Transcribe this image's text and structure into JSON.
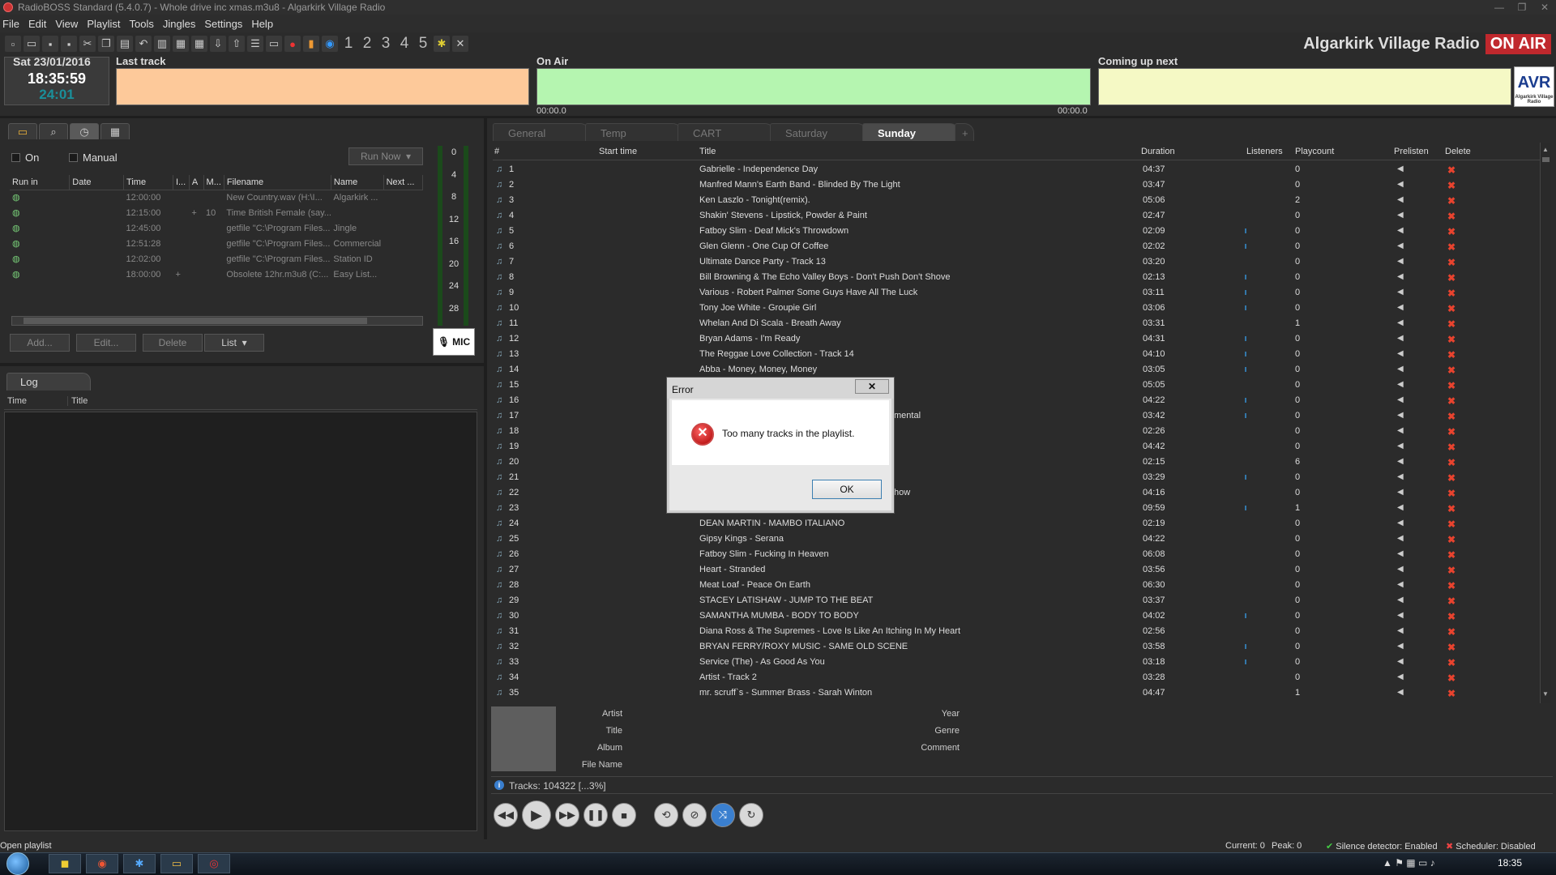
{
  "window": {
    "title": "RadioBOSS Standard (5.4.0.7) - Whole drive inc xmas.m3u8 - Algarkirk Village Radio"
  },
  "menu": [
    "File",
    "Edit",
    "View",
    "Playlist",
    "Tools",
    "Jingles",
    "Settings",
    "Help"
  ],
  "toolbar_numbers": [
    "1",
    "2",
    "3",
    "4",
    "5"
  ],
  "station": {
    "name": "Algarkirk Village Radio",
    "on_air": "ON AIR",
    "logo": "AVR",
    "logo_sub": "Algarkirk Village Radio"
  },
  "clock": {
    "date": "Sat 23/01/2016",
    "time": "18:35:59",
    "elapsed": "24:01"
  },
  "last_track": {
    "label": "Last track",
    "color": "#fdc99a"
  },
  "on_air_bar": {
    "label": "On Air",
    "color": "#b5f5b0",
    "start": "00:00.0",
    "end": "00:00.0"
  },
  "coming_up": {
    "label": "Coming up next",
    "color": "#f5f9c5"
  },
  "scheduler": {
    "on_label": "On",
    "manual_label": "Manual",
    "run_now": "Run Now",
    "columns": [
      "Run in",
      "Date",
      "Time",
      "I...",
      "A",
      "M...",
      "Filename",
      "Name",
      "Next ..."
    ],
    "rows": [
      {
        "time": "12:00:00",
        "i": "",
        "a": "",
        "m": "",
        "filename": "New Country.wav  (H:\\I...",
        "name": "Algarkirk ..."
      },
      {
        "time": "12:15:00",
        "i": "",
        "a": "+",
        "m": "10",
        "filename": "Time British Female  (say...",
        "name": ""
      },
      {
        "time": "12:45:00",
        "i": "",
        "a": "",
        "m": "",
        "filename": "getfile \"C:\\Program Files...",
        "name": "Jingle"
      },
      {
        "time": "12:51:28",
        "i": "",
        "a": "",
        "m": "",
        "filename": "getfile \"C:\\Program Files...",
        "name": "Commercial"
      },
      {
        "time": "12:02:00",
        "i": "",
        "a": "",
        "m": "",
        "filename": "getfile \"C:\\Program Files...",
        "name": "Station ID"
      },
      {
        "time": "18:00:00",
        "i": "+",
        "a": "",
        "m": "",
        "filename": "Obsolete 12hr.m3u8  (C:...",
        "name": "Easy List..."
      }
    ],
    "buttons": {
      "add": "Add...",
      "edit": "Edit...",
      "delete": "Delete",
      "list": "List"
    }
  },
  "vu_scale": [
    "0",
    "4",
    "8",
    "12",
    "16",
    "20",
    "24",
    "28"
  ],
  "mic_label": "MIC",
  "log": {
    "tab": "Log",
    "columns": [
      "Time",
      "Title"
    ]
  },
  "playlist_tabs": [
    "General",
    "Temp",
    "CART",
    "Saturday",
    "Sunday"
  ],
  "playlist": {
    "columns": [
      "#",
      "Start time",
      "Title",
      "Duration",
      "Listeners",
      "Playcount",
      "Prelisten",
      "Delete"
    ],
    "rows": [
      {
        "n": "1",
        "title": "Gabrielle - Independence Day",
        "dur": "04:37",
        "pc": "0"
      },
      {
        "n": "2",
        "title": "Manfred Mann's Earth Band - Blinded By The Light",
        "dur": "03:47",
        "pc": "0"
      },
      {
        "n": "3",
        "title": "Ken Laszlo - Tonight(remix).",
        "dur": "05:06",
        "pc": "2"
      },
      {
        "n": "4",
        "title": "Shakin' Stevens - Lipstick, Powder & Paint",
        "dur": "02:47",
        "pc": "0"
      },
      {
        "n": "5",
        "title": "Fatboy Slim - Deaf Mick's Throwdown",
        "dur": "02:09",
        "pc": "0"
      },
      {
        "n": "6",
        "title": "Glen Glenn - One Cup Of Coffee",
        "dur": "02:02",
        "pc": "0"
      },
      {
        "n": "7",
        "title": "Ultimate Dance Party - Track 13",
        "dur": "03:20",
        "pc": "0"
      },
      {
        "n": "8",
        "title": "Bill Browning & The Echo Valley Boys - Don't Push Don't Shove",
        "dur": "02:13",
        "pc": "0"
      },
      {
        "n": "9",
        "title": "Various - Robert Palmer  Some Guys Have All The Luck",
        "dur": "03:11",
        "pc": "0"
      },
      {
        "n": "10",
        "title": "Tony Joe White - Groupie Girl",
        "dur": "03:06",
        "pc": "0"
      },
      {
        "n": "11",
        "title": "Whelan And Di Scala - Breath Away",
        "dur": "03:31",
        "pc": "1"
      },
      {
        "n": "12",
        "title": "Bryan Adams - I'm Ready",
        "dur": "04:31",
        "pc": "0"
      },
      {
        "n": "13",
        "title": "The Reggae Love Collection - Track 14",
        "dur": "04:10",
        "pc": "0"
      },
      {
        "n": "14",
        "title": "Abba - Money, Money, Money",
        "dur": "03:05",
        "pc": "0"
      },
      {
        "n": "15",
        "title": "",
        "dur": "05:05",
        "pc": "0"
      },
      {
        "n": "16",
        "title": "",
        "dur": "04:22",
        "pc": "0"
      },
      {
        "n": "17",
        "title": "",
        "dur": "03:42",
        "pc": "0"
      },
      {
        "n": "18",
        "title": "",
        "dur": "02:26",
        "pc": "0"
      },
      {
        "n": "19",
        "title": "",
        "dur": "04:42",
        "pc": "0"
      },
      {
        "n": "20",
        "title": "",
        "dur": "02:15",
        "pc": "6"
      },
      {
        "n": "21",
        "title": "",
        "dur": "03:29",
        "pc": "0"
      },
      {
        "n": "22",
        "title": "",
        "dur": "04:16",
        "pc": "0"
      },
      {
        "n": "23",
        "title": "",
        "dur": "09:59",
        "pc": "1"
      },
      {
        "n": "24",
        "title": "DEAN MARTIN - MAMBO ITALIANO",
        "dur": "02:19",
        "pc": "0"
      },
      {
        "n": "25",
        "title": "Gipsy Kings - Serana",
        "dur": "04:22",
        "pc": "0"
      },
      {
        "n": "26",
        "title": "Fatboy Slim - Fucking In Heaven",
        "dur": "06:08",
        "pc": "0"
      },
      {
        "n": "27",
        "title": "Heart - Stranded",
        "dur": "03:56",
        "pc": "0"
      },
      {
        "n": "28",
        "title": "Meat Loaf - Peace On Earth",
        "dur": "06:30",
        "pc": "0"
      },
      {
        "n": "29",
        "title": "STACEY LATISHAW - JUMP TO THE BEAT",
        "dur": "03:37",
        "pc": "0"
      },
      {
        "n": "30",
        "title": "SAMANTHA MUMBA - BODY TO BODY",
        "dur": "04:02",
        "pc": "0"
      },
      {
        "n": "31",
        "title": "Diana Ross & The Supremes - Love Is Like An Itching In My Heart",
        "dur": "02:56",
        "pc": "0"
      },
      {
        "n": "32",
        "title": "BRYAN FERRY/ROXY MUSIC - SAME OLD SCENE",
        "dur": "03:58",
        "pc": "0"
      },
      {
        "n": "33",
        "title": "Service (The) - As Good As You",
        "dur": "03:18",
        "pc": "0"
      },
      {
        "n": "34",
        "title": "Artist - Track 2",
        "dur": "03:28",
        "pc": "0"
      },
      {
        "n": "35",
        "title": "mr. scruff`s - Summer Brass - Sarah Winton",
        "dur": "04:47",
        "pc": "1"
      }
    ],
    "peek_row17": "mental",
    "peek_row22": "how"
  },
  "track_info": {
    "artist": "Artist",
    "title": "Title",
    "album": "Album",
    "filename": "File Name",
    "year": "Year",
    "genre": "Genre",
    "comment": "Comment"
  },
  "tracks_status": "Tracks: 104322 [...3%]",
  "status": {
    "left": "Open playlist",
    "current": "Current: 0",
    "peak": "Peak: 0",
    "silence": "Silence detector: Enabled",
    "scheduler": "Scheduler: Disabled"
  },
  "taskbar": {
    "time": "18:35"
  },
  "dialog": {
    "title": "Error",
    "message": "Too many tracks in the playlist.",
    "ok": "OK",
    "close": "✕"
  }
}
